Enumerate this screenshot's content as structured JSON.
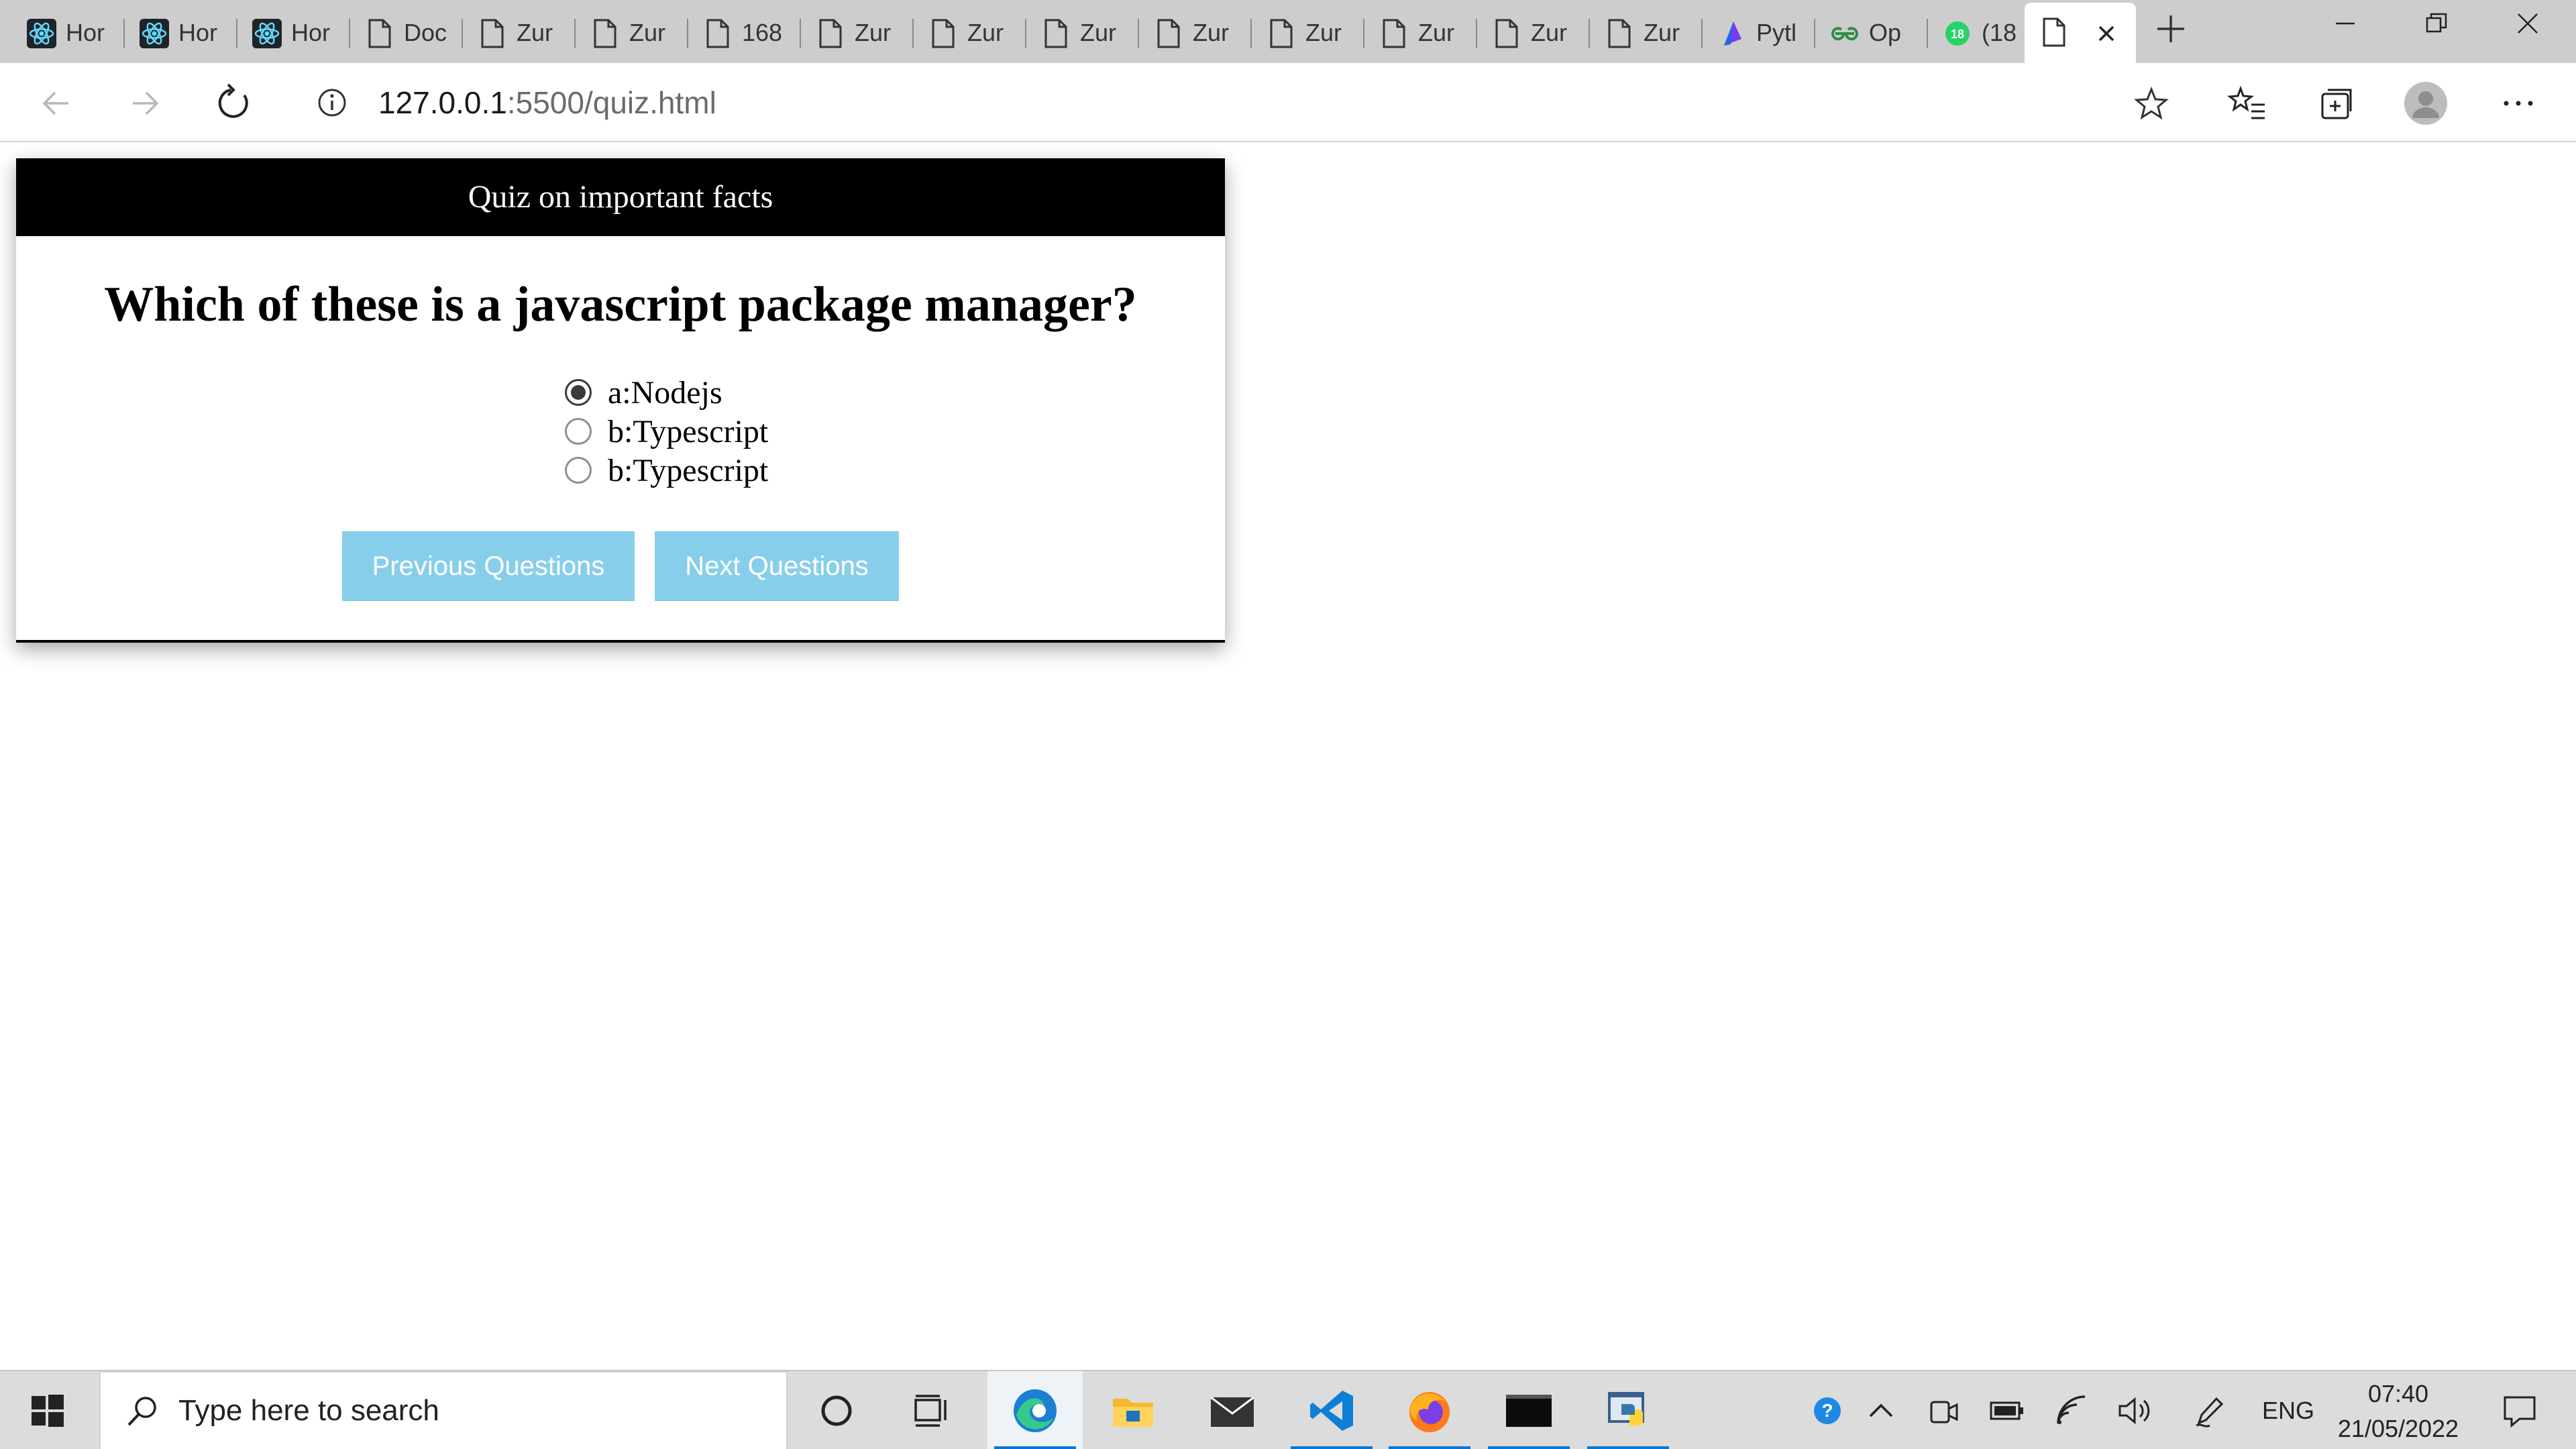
{
  "browser": {
    "tabs": [
      {
        "label": "Hor",
        "icon": "react-icon"
      },
      {
        "label": "Hor",
        "icon": "react-icon"
      },
      {
        "label": "Hor",
        "icon": "react-icon"
      },
      {
        "label": "Doc",
        "icon": "page-icon"
      },
      {
        "label": "Zur",
        "icon": "page-icon"
      },
      {
        "label": "Zur",
        "icon": "page-icon"
      },
      {
        "label": "168",
        "icon": "page-icon"
      },
      {
        "label": "Zur",
        "icon": "page-icon"
      },
      {
        "label": "Zur",
        "icon": "page-icon"
      },
      {
        "label": "Zur",
        "icon": "page-icon"
      },
      {
        "label": "Zur",
        "icon": "page-icon"
      },
      {
        "label": "Zur",
        "icon": "page-icon"
      },
      {
        "label": "Zur",
        "icon": "page-icon"
      },
      {
        "label": "Zur",
        "icon": "page-icon"
      },
      {
        "label": "Zur",
        "icon": "page-icon"
      },
      {
        "label": "Pytl",
        "icon": "prisma-icon"
      },
      {
        "label": "Op",
        "icon": "geeksforgeeks-icon"
      },
      {
        "label": "(18",
        "icon": "whatsapp-icon",
        "badge": "18"
      },
      {
        "label": "",
        "icon": "page-icon",
        "active": true
      }
    ],
    "address": {
      "host": "127.0.0.1",
      "path": ":5500/quiz.html"
    }
  },
  "quiz": {
    "header": "Quiz on important facts",
    "question": "Which of these is a javascript package manager?",
    "answers": [
      {
        "label": "a:Nodejs",
        "checked": true
      },
      {
        "label": "b:Typescript",
        "checked": false
      },
      {
        "label": "b:Typescript",
        "checked": false
      }
    ],
    "prev_label": "Previous Questions",
    "next_label": "Next Questions",
    "button_color": "#87ceeb"
  },
  "taskbar": {
    "search_placeholder": "Type here to search",
    "language": "ENG",
    "time": "07:40",
    "date": "21/05/2022",
    "apps": [
      "cortana-icon",
      "task-view-icon",
      "edge-icon",
      "file-explorer-icon",
      "mail-icon",
      "vscode-icon",
      "firefox-icon",
      "terminal-icon",
      "python-idle-icon"
    ]
  },
  "colors": {
    "accent": "#0078d7",
    "quiz_header_bg": "#000000"
  }
}
